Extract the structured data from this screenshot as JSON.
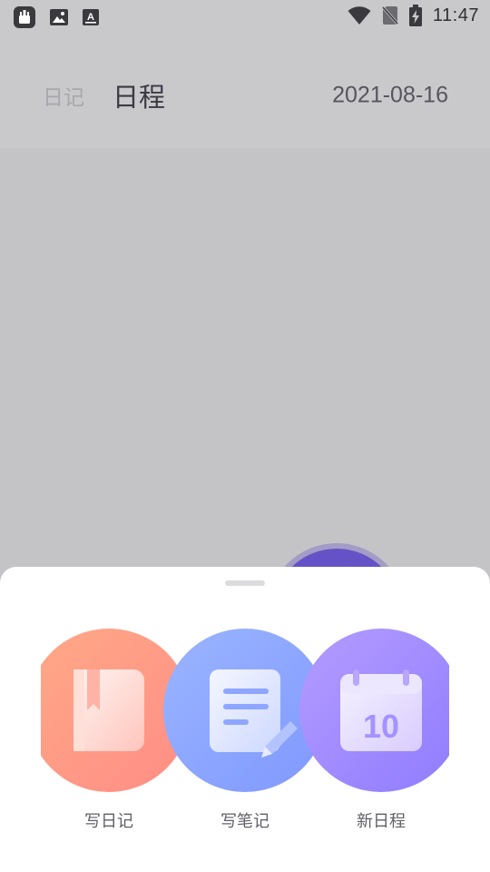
{
  "status_bar": {
    "time": "11:47",
    "left_icons": [
      "robot-notification-icon",
      "image-notification-icon",
      "text-notification-icon"
    ],
    "right_icons": [
      "wifi-icon",
      "no-sim-icon",
      "battery-charging-icon"
    ]
  },
  "header": {
    "tabs": [
      {
        "label": "日记",
        "active": false
      },
      {
        "label": "日程",
        "active": true
      }
    ],
    "date": "2021-08-16"
  },
  "sheet": {
    "actions": [
      {
        "label": "写日记",
        "icon": "diary-book-icon",
        "color": "#ff9a86"
      },
      {
        "label": "写笔记",
        "icon": "note-pen-icon",
        "color": "#8aa6ff"
      },
      {
        "label": "新日程",
        "icon": "calendar-icon",
        "color": "#a08cff",
        "calendar_day": "10"
      }
    ]
  },
  "colors": {
    "fab": "#6552c6",
    "overlay": "#c4c4c6"
  }
}
